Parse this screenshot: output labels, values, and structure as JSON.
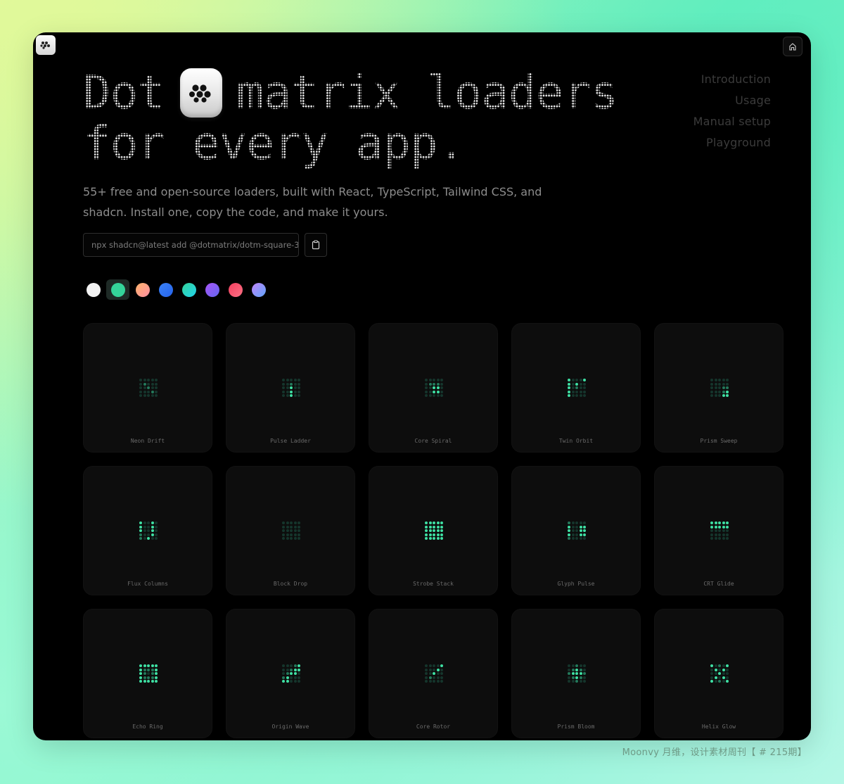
{
  "header": {
    "title_line1_a": "Dot",
    "title_line1_b": "matrix loaders",
    "title_line2": "for every app.",
    "subtitle": "55+ free and open-source loaders, built with React, TypeScript, Tailwind CSS, and shadcn. Install one, copy the code, and make it yours."
  },
  "toc": {
    "items": [
      "Introduction",
      "Usage",
      "Manual setup",
      "Playground"
    ]
  },
  "command": {
    "text": "npx shadcn@latest add @dotmatrix/dotm-square-3",
    "copy_icon": "clipboard-icon"
  },
  "swatches": [
    {
      "name": "white",
      "color": "#f2f2f2"
    },
    {
      "name": "emerald",
      "color": "#34d399",
      "selected": true
    },
    {
      "name": "peach",
      "color": "linear-gradient(135deg,#ffb36b,#ff8fa3)"
    },
    {
      "name": "blue",
      "color": "linear-gradient(135deg,#3b82f6,#2563eb)"
    },
    {
      "name": "mint",
      "color": "linear-gradient(135deg,#34d399,#22d3ee)"
    },
    {
      "name": "violet",
      "color": "linear-gradient(135deg,#a855f7,#6366f1)"
    },
    {
      "name": "rose",
      "color": "linear-gradient(135deg,#f43f5e,#fb7185)"
    },
    {
      "name": "lilac",
      "color": "linear-gradient(135deg,#c084fc,#60a5fa)"
    }
  ],
  "loaders": [
    {
      "name": "Neon Drift",
      "on": [],
      "mid": [
        6,
        12,
        18
      ]
    },
    {
      "name": "Pulse Ladder",
      "on": [
        12,
        17,
        22
      ],
      "mid": [
        7
      ]
    },
    {
      "name": "Core Spiral",
      "on": [
        12,
        13,
        17,
        18
      ],
      "mid": [
        6,
        7,
        8
      ]
    },
    {
      "name": "Twin Orbit",
      "on": [
        0,
        5,
        10,
        15,
        20,
        7,
        4
      ],
      "mid": [
        12
      ]
    },
    {
      "name": "Prism Sweep",
      "on": [
        19,
        23,
        24
      ],
      "mid": [
        13,
        14,
        18
      ]
    },
    {
      "name": "Flux Columns",
      "on": [
        0,
        5,
        10,
        3,
        8,
        13,
        18,
        22
      ],
      "mid": [
        15,
        20
      ]
    },
    {
      "name": "Block Drop",
      "on": [],
      "mid": []
    },
    {
      "name": "Strobe Stack",
      "on": [
        0,
        1,
        2,
        3,
        4,
        5,
        6,
        7,
        8,
        9,
        10,
        11,
        12,
        13,
        14,
        15,
        16,
        17,
        18,
        19,
        20,
        21,
        22,
        23,
        24
      ],
      "mid": []
    },
    {
      "name": "Glyph Pulse",
      "on": [
        5,
        10,
        15,
        8,
        13,
        18,
        9,
        14,
        19
      ],
      "mid": [
        0,
        20
      ]
    },
    {
      "name": "CRT Glide",
      "on": [
        0,
        1,
        2,
        3,
        4,
        5,
        6,
        7,
        8,
        9
      ],
      "mid": []
    },
    {
      "name": "Echo Ring",
      "on": [
        0,
        1,
        2,
        3,
        4,
        5,
        9,
        10,
        14,
        15,
        19,
        20,
        21,
        22,
        23,
        24
      ],
      "mid": [
        6,
        7,
        8,
        11,
        13,
        16,
        17,
        18
      ]
    },
    {
      "name": "Origin Wave",
      "on": [
        4,
        8,
        9,
        12,
        13,
        16,
        20,
        21
      ],
      "mid": [
        3,
        7,
        11,
        15
      ]
    },
    {
      "name": "Core Rotor",
      "on": [
        4,
        8,
        12
      ],
      "mid": [
        16
      ]
    },
    {
      "name": "Prism Bloom",
      "on": [
        7,
        11,
        12,
        13,
        17
      ],
      "mid": [
        2,
        10,
        14,
        22,
        6,
        8,
        16,
        18
      ]
    },
    {
      "name": "Helix Glow",
      "on": [
        0,
        4,
        6,
        8,
        12,
        16,
        18,
        20,
        24
      ],
      "mid": [
        2,
        22
      ]
    }
  ],
  "watermark": "Moonvy 月维，设计素材周刊【 # 215期】"
}
